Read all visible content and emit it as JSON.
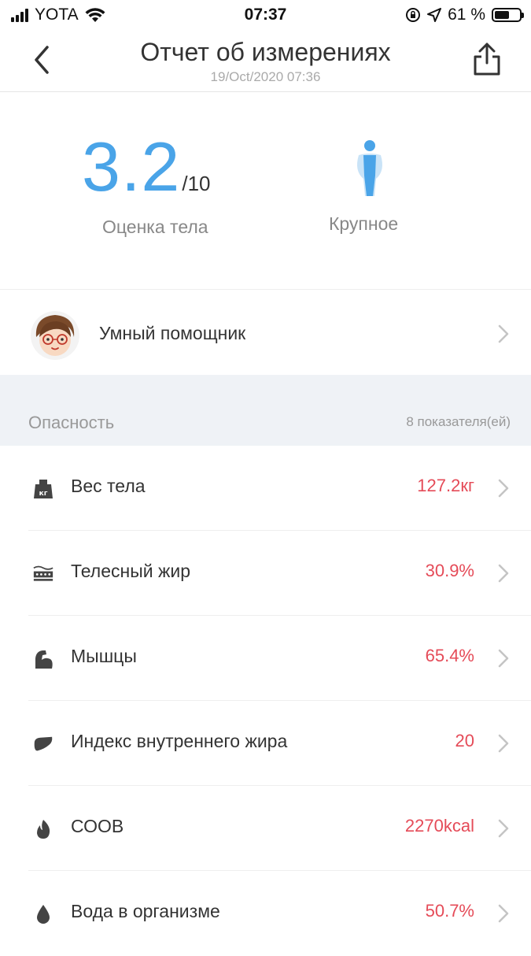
{
  "status_bar": {
    "carrier": "YOTA",
    "time": "07:37",
    "battery_percent": "61 %",
    "battery_level": 0.61
  },
  "nav": {
    "title": "Отчет об измерениях",
    "subtitle": "19/Oct/2020 07:36",
    "back_icon": "chevron-left-icon",
    "share_icon": "share-icon"
  },
  "score": {
    "value": "3.2",
    "max": "/10",
    "label": "Оценка тела",
    "body_type": "Крупное",
    "accent": "#4aa4e8"
  },
  "assistant": {
    "label": "Умный помощник"
  },
  "section": {
    "title": "Опасность",
    "count": "8 показателя(ей)"
  },
  "metrics": [
    {
      "icon": "weight-icon",
      "label": "Вес тела",
      "value": "127.2кг"
    },
    {
      "icon": "body-fat-icon",
      "label": "Телесный жир",
      "value": "30.9%"
    },
    {
      "icon": "muscle-icon",
      "label": "Мышцы",
      "value": "65.4%"
    },
    {
      "icon": "visceral-fat-icon",
      "label": "Индекс внутреннего жира",
      "value": "20"
    },
    {
      "icon": "flame-icon",
      "label": "СООВ",
      "value": "2270kcal"
    },
    {
      "icon": "water-drop-icon",
      "label": "Вода в организме",
      "value": "50.7%"
    }
  ],
  "colors": {
    "warning_value": "#e54b58",
    "section_bg": "#eff2f6"
  }
}
